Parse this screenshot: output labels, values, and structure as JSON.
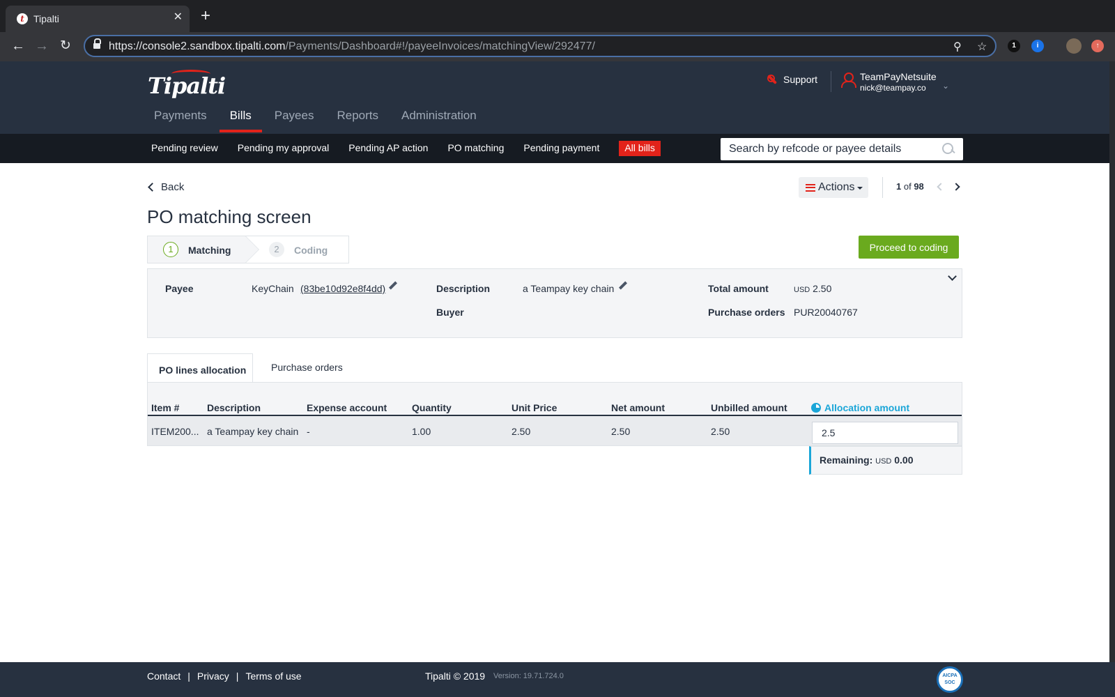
{
  "browser": {
    "tab_title": "Tipalti",
    "tab_favicon": "t",
    "close_glyph": "✕",
    "new_tab_glyph": "+",
    "url_host": "https://console2.sandbox.tipalti.com",
    "url_path": "/Payments/Dashboard#!/payeeInvoices/matchingView/292477/",
    "ext_1": "1",
    "ext_2": "i"
  },
  "header": {
    "logo": "Tipalti",
    "support_label": "Support",
    "user_name": "TeamPayNetsuite",
    "user_email": "nick@teampay.co"
  },
  "main_nav": [
    "Payments",
    "Bills",
    "Payees",
    "Reports",
    "Administration"
  ],
  "sub_nav": {
    "items": [
      "Pending review",
      "Pending my approval",
      "Pending AP action",
      "PO matching",
      "Pending payment",
      "All bills"
    ],
    "search_placeholder": "Search by refcode or payee details"
  },
  "toolbar": {
    "back_label": "Back",
    "actions_label": "Actions",
    "pager_current": "1",
    "pager_of": "of",
    "pager_total": "98"
  },
  "page": {
    "title": "PO matching screen",
    "steps": [
      {
        "num": "1",
        "label": "Matching"
      },
      {
        "num": "2",
        "label": "Coding"
      }
    ],
    "proceed_label": "Proceed to coding"
  },
  "summary": {
    "payee_label": "Payee",
    "payee_name": "KeyChain",
    "payee_id": "(83be10d92e8f4dd)",
    "description_label": "Description",
    "description_value": "a Teampay key chain",
    "buyer_label": "Buyer",
    "total_label": "Total amount",
    "total_currency": "USD",
    "total_value": "2.50",
    "po_label": "Purchase orders",
    "po_value": "PUR20040767"
  },
  "tabs": [
    "PO lines allocation",
    "Purchase orders"
  ],
  "table": {
    "headers": [
      "Item #",
      "Description",
      "Expense account",
      "Quantity",
      "Unit Price",
      "Net amount",
      "Unbilled amount",
      "Allocation amount"
    ],
    "rows": [
      {
        "item": "ITEM200...",
        "description": "a Teampay key chain",
        "expense_account": "-",
        "quantity": "1.00",
        "unit_price": "2.50",
        "net_amount": "2.50",
        "unbilled_amount": "2.50",
        "allocation_amount": "2.5"
      }
    ],
    "remaining_label": "Remaining:",
    "remaining_currency": "USD",
    "remaining_value": "0.00"
  },
  "footer": {
    "links": [
      "Contact",
      "Privacy",
      "Terms of use"
    ],
    "separator": "|",
    "copyright": "Tipalti © 2019",
    "version": "Version: 19.71.724.0",
    "badge_top": "AICPA",
    "badge_bottom": "SOC"
  },
  "colors": {
    "accent_red": "#e2231a",
    "header_navy": "#273140",
    "success_green": "#6aaa1e",
    "info_blue": "#1ba6d8"
  }
}
